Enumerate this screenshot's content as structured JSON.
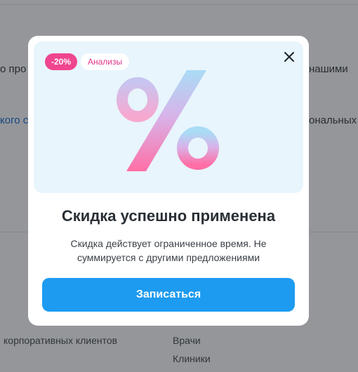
{
  "background": {
    "line1_left": "о про",
    "line1_right": "нашими",
    "line2_left": "кого с",
    "line2_right": "ональных",
    "footer_left": "корпоративных клиентов",
    "footer_right_1": "Врачи",
    "footer_right_2": "Клиники"
  },
  "modal": {
    "badge_discount": "-20%",
    "badge_category": "Анализы",
    "hero_symbol": "%",
    "title": "Скидка успешно применена",
    "description": "Скидка действует ограниченное время. Не суммируется с другими предложениями",
    "cta_label": "Записаться",
    "close_icon": "close-icon"
  },
  "colors": {
    "accent": "#1d9bf0",
    "badge_pink": "#f0458f",
    "hero_bg": "#e8f5fc"
  }
}
